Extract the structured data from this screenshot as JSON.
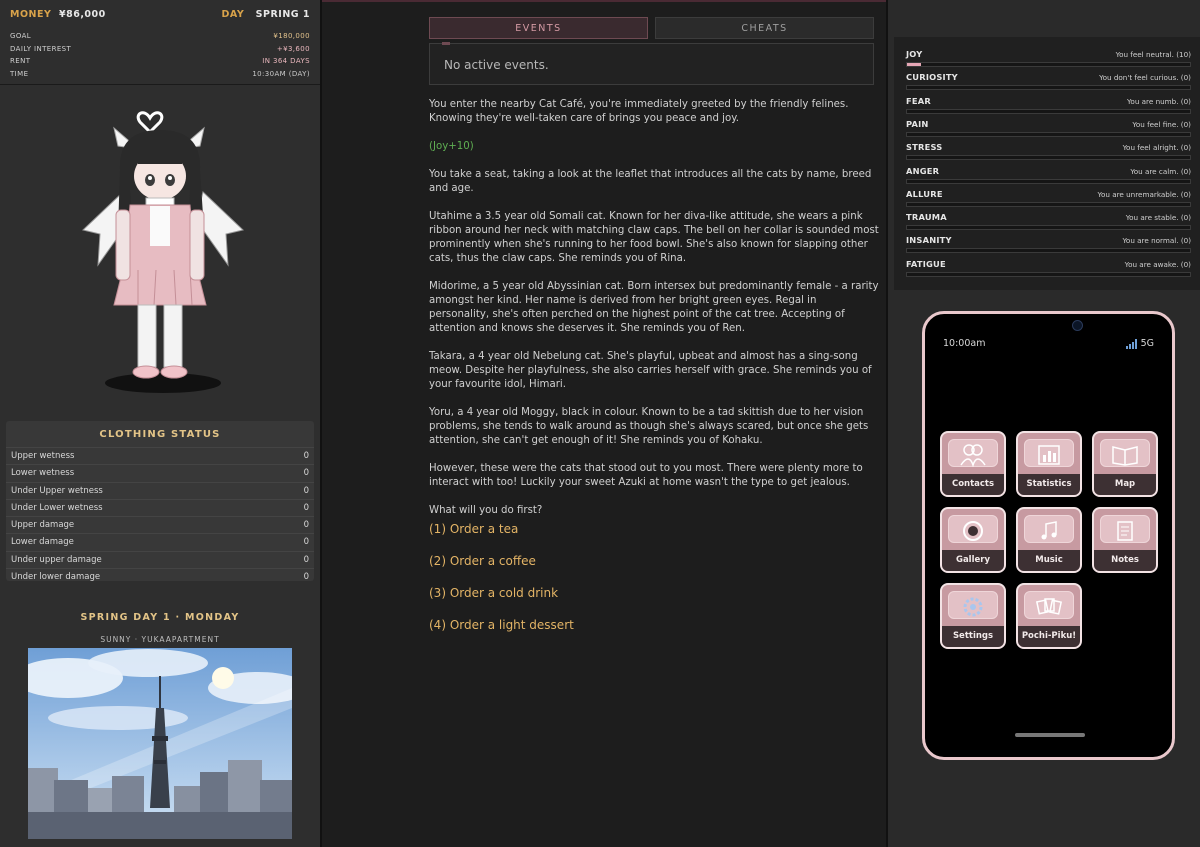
{
  "header": {
    "money_label": "MONEY",
    "money_value": "¥86,000",
    "day_label": "DAY",
    "day_value": "SPRING 1"
  },
  "finance": [
    {
      "label": "GOAL",
      "value": "¥180,000"
    },
    {
      "label": "DAILY INTEREST",
      "value": "+¥3,600"
    },
    {
      "label": "RENT",
      "value": "IN 364 DAYS"
    },
    {
      "label": "TIME",
      "value": "10:30AM (DAY)"
    }
  ],
  "clothing": {
    "title": "CLOTHING STATUS",
    "rows": [
      {
        "label": "Upper wetness",
        "value": "0"
      },
      {
        "label": "Lower wetness",
        "value": "0"
      },
      {
        "label": "Under Upper wetness",
        "value": "0"
      },
      {
        "label": "Under Lower wetness",
        "value": "0"
      },
      {
        "label": "Upper damage",
        "value": "0"
      },
      {
        "label": "Lower damage",
        "value": "0"
      },
      {
        "label": "Under upper damage",
        "value": "0"
      },
      {
        "label": "Under lower damage",
        "value": "0"
      }
    ]
  },
  "day_info": {
    "title": "SPRING DAY 1 · MONDAY",
    "weather": "SUNNY · YUKAAPARTMENT"
  },
  "tabs": [
    {
      "label": "EVENTS",
      "active": true
    },
    {
      "label": "CHEATS",
      "active": false
    }
  ],
  "events": {
    "text": "No active events."
  },
  "story": {
    "p1": "You enter the nearby Cat Café, you're immediately greeted by the friendly felines. Knowing they're well-taken care of brings you peace and joy.",
    "joy": "(Joy+10)",
    "p2": "You take a seat, taking a look at the leaflet that introduces all the cats by name, breed and age.",
    "p3": "Utahime a 3.5 year old Somali cat. Known for her diva-like attitude, she wears a pink ribbon around her neck with matching claw caps. The bell on her collar is sounded most prominently when she's running to her food bowl. She's also known for slapping other cats, thus the claw caps. She reminds you of Rina.",
    "p4": "Midorime, a 5 year old Abyssinian cat. Born intersex but predominantly female - a rarity amongst her kind. Her name is derived from her bright green eyes. Regal in personality, she's often perched on the highest point of the cat tree. Accepting of attention and knows she deserves it. She reminds you of Ren.",
    "p5": "Takara, a 4 year old Nebelung cat. She's playful, upbeat and almost has a sing-song meow. Despite her playfulness, she also carries herself with grace. She reminds you of your favourite idol, Himari.",
    "p6": "Yoru, a 4 year old Moggy, black in colour. Known to be a tad skittish due to her vision problems, she tends to walk around as though she's always scared, but once she gets attention, she can't get enough of it! She reminds you of Kohaku.",
    "p7": "However, these were the cats that stood out to you most. There were plenty more to interact with too! Luckily your sweet Azuki at home wasn't the type to get jealous.",
    "p8": "What will you do first?"
  },
  "choices": [
    "(1) Order a tea",
    "(2) Order a coffee",
    "(3) Order a cold drink",
    "(4) Order a light dessert"
  ],
  "stats": [
    {
      "name": "JOY",
      "desc": "You feel neutral. (10)",
      "value": 10
    },
    {
      "name": "CURIOSITY",
      "desc": "You don't feel curious. (0)",
      "value": 0
    },
    {
      "name": "FEAR",
      "desc": "You are numb. (0)",
      "value": 0
    },
    {
      "name": "PAIN",
      "desc": "You feel fine. (0)",
      "value": 0
    },
    {
      "name": "STRESS",
      "desc": "You feel alright. (0)",
      "value": 0
    },
    {
      "name": "ANGER",
      "desc": "You are calm. (0)",
      "value": 0
    },
    {
      "name": "ALLURE",
      "desc": "You are unremarkable. (0)",
      "value": 0
    },
    {
      "name": "TRAUMA",
      "desc": "You are stable. (0)",
      "value": 0
    },
    {
      "name": "INSANITY",
      "desc": "You are normal. (0)",
      "value": 0
    },
    {
      "name": "FATIGUE",
      "desc": "You are awake. (0)",
      "value": 0
    }
  ],
  "phone": {
    "time": "10:00am",
    "network": "5G",
    "apps": [
      {
        "label": "Contacts",
        "icon": "contacts-icon"
      },
      {
        "label": "Statistics",
        "icon": "statistics-icon"
      },
      {
        "label": "Map",
        "icon": "map-icon"
      },
      {
        "label": "Gallery",
        "icon": "gallery-icon"
      },
      {
        "label": "Music",
        "icon": "music-icon"
      },
      {
        "label": "Notes",
        "icon": "notes-icon"
      },
      {
        "label": "Settings",
        "icon": "settings-icon"
      },
      {
        "label": "Pochi-Piku!",
        "icon": "pochi-piku-icon"
      }
    ]
  },
  "colors": {
    "gold": "#d9a34a",
    "pink_accent": "#e6a7b6",
    "choice": "#e3b466",
    "joy_green": "#5fae52"
  }
}
